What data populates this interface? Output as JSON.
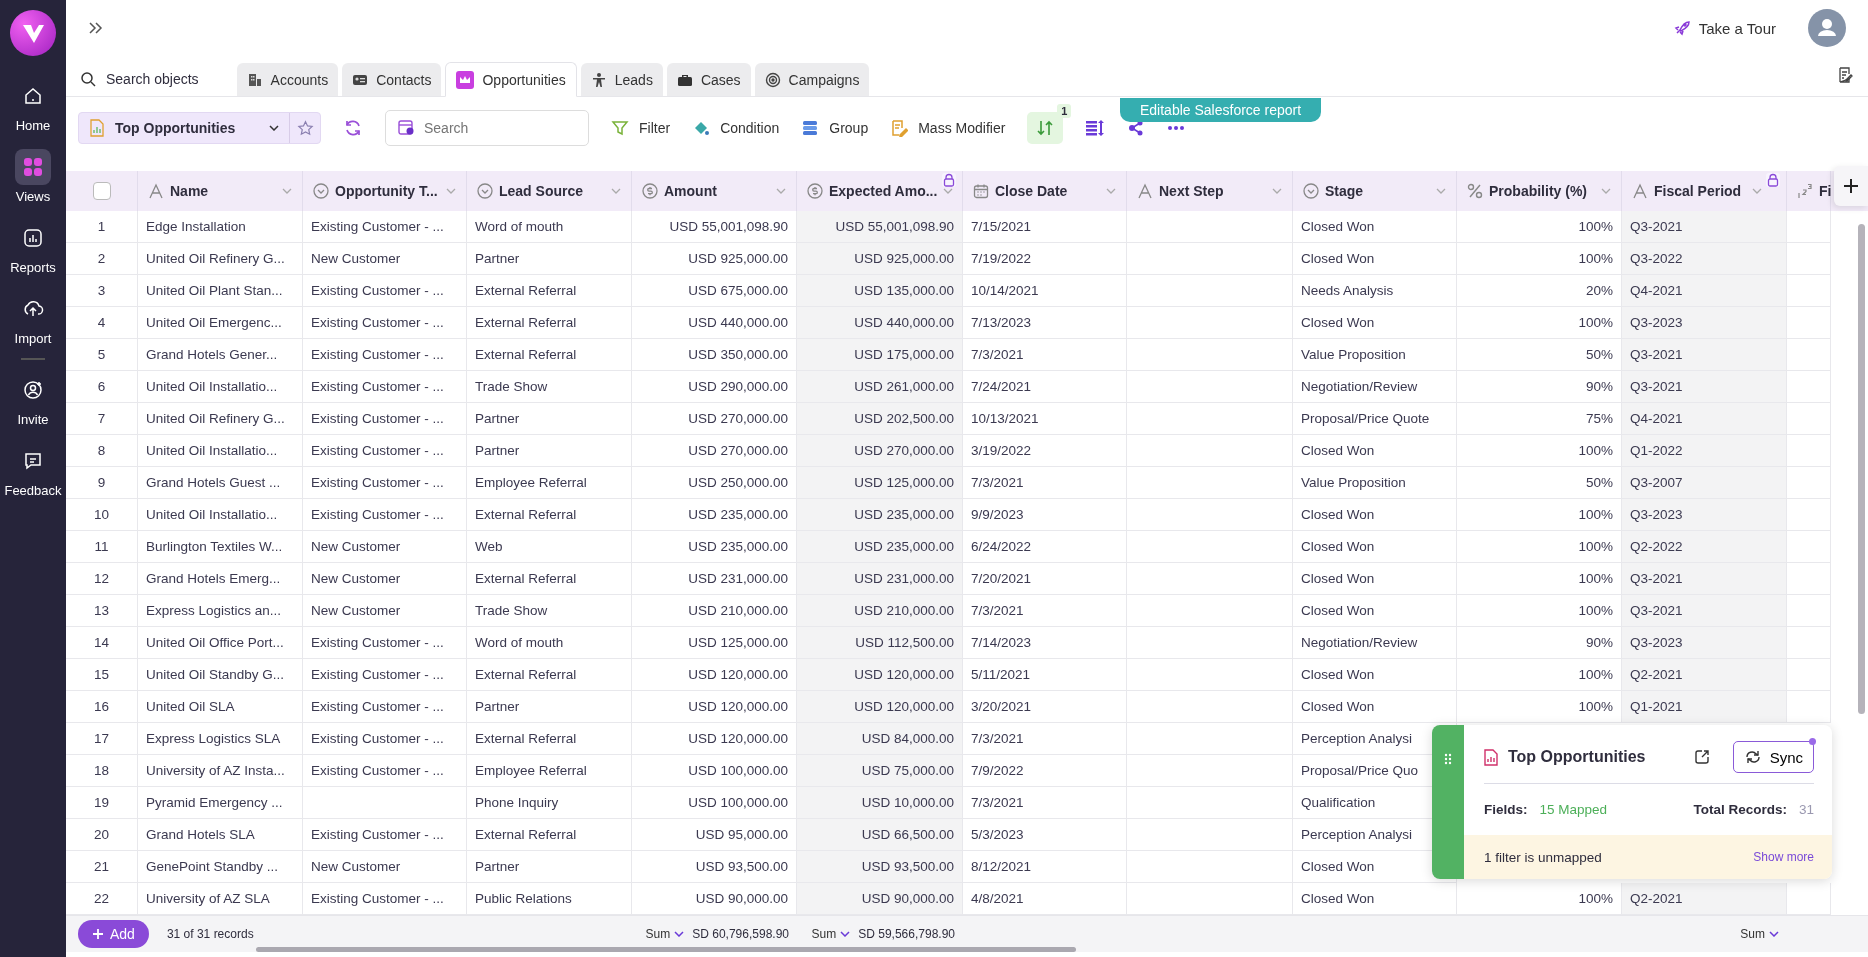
{
  "sidebar": {
    "items": [
      {
        "label": "Home",
        "selected": false
      },
      {
        "label": "Views",
        "selected": true
      },
      {
        "label": "Reports",
        "selected": false
      },
      {
        "label": "Import",
        "selected": false
      },
      {
        "label": "Invite",
        "selected": false
      },
      {
        "label": "Feedback",
        "selected": false
      }
    ]
  },
  "topbar": {
    "tour_label": "Take a Tour"
  },
  "object_tabs": {
    "search_label": "Search objects",
    "tabs": [
      {
        "label": "Accounts",
        "selected": false
      },
      {
        "label": "Contacts",
        "selected": false
      },
      {
        "label": "Opportunities",
        "selected": true
      },
      {
        "label": "Leads",
        "selected": false
      },
      {
        "label": "Cases",
        "selected": false
      },
      {
        "label": "Campaigns",
        "selected": false
      }
    ]
  },
  "toolbar": {
    "view_name": "Top Opportunities",
    "search_placeholder": "Search",
    "actions": [
      {
        "label": "Filter",
        "kind": "filter"
      },
      {
        "label": "Condition",
        "kind": "condition"
      },
      {
        "label": "Group",
        "kind": "group"
      },
      {
        "label": "Mass Modifier",
        "kind": "modifier"
      }
    ],
    "sort": {
      "active": true,
      "badge": "1"
    },
    "banner": "Editable Salesforce report"
  },
  "table": {
    "select_all": {
      "checked": false
    },
    "columns": [
      {
        "label": "Name",
        "kind": "text",
        "locked": false
      },
      {
        "label": "Opportunity T...",
        "kind": "picklist",
        "locked": false
      },
      {
        "label": "Lead Source",
        "kind": "picklist",
        "locked": false
      },
      {
        "label": "Amount",
        "kind": "currency",
        "locked": false,
        "sum": {
          "label": "Sum",
          "value": "SD 60,796,598.90"
        }
      },
      {
        "label": "Expected Amo...",
        "kind": "currency",
        "locked": true,
        "sum": {
          "label": "Sum",
          "value": "SD 59,566,798.90"
        }
      },
      {
        "label": "Close Date",
        "kind": "date",
        "locked": false
      },
      {
        "label": "Next Step",
        "kind": "text",
        "locked": false
      },
      {
        "label": "Stage",
        "kind": "picklist",
        "locked": false
      },
      {
        "label": "Probability (%)",
        "kind": "percent",
        "locked": false
      },
      {
        "label": "Fiscal Period",
        "kind": "text",
        "locked": true,
        "sum": {
          "label": "Sum"
        }
      },
      {
        "label": "Fi",
        "kind": "number",
        "locked": false
      }
    ],
    "rows": [
      {
        "number": "1",
        "cells": [
          "Edge Installation",
          "Existing Customer - ...",
          "Word of mouth",
          "USD 55,001,098.90",
          "USD 55,001,098.90",
          "7/15/2021",
          null,
          "Closed Won",
          "100%",
          "Q3-2021",
          null
        ]
      },
      {
        "number": "2",
        "cells": [
          "United Oil Refinery G...",
          "New Customer",
          "Partner",
          "USD 925,000.00",
          "USD 925,000.00",
          "7/19/2022",
          null,
          "Closed Won",
          "100%",
          "Q3-2022",
          null
        ]
      },
      {
        "number": "3",
        "cells": [
          "United Oil Plant Stan...",
          "Existing Customer - ...",
          "External Referral",
          "USD 675,000.00",
          "USD 135,000.00",
          "10/14/2021",
          null,
          "Needs Analysis",
          "20%",
          "Q4-2021",
          null
        ]
      },
      {
        "number": "4",
        "cells": [
          "United Oil Emergenc...",
          "Existing Customer - ...",
          "External Referral",
          "USD 440,000.00",
          "USD 440,000.00",
          "7/13/2023",
          null,
          "Closed Won",
          "100%",
          "Q3-2023",
          null
        ]
      },
      {
        "number": "5",
        "cells": [
          "Grand Hotels Gener...",
          "Existing Customer - ...",
          "External Referral",
          "USD 350,000.00",
          "USD 175,000.00",
          "7/3/2021",
          null,
          "Value Proposition",
          "50%",
          "Q3-2021",
          null
        ]
      },
      {
        "number": "6",
        "cells": [
          "United Oil Installatio...",
          "Existing Customer - ...",
          "Trade Show",
          "USD 290,000.00",
          "USD 261,000.00",
          "7/24/2021",
          null,
          "Negotiation/Review",
          "90%",
          "Q3-2021",
          null
        ]
      },
      {
        "number": "7",
        "cells": [
          "United Oil Refinery G...",
          "Existing Customer - ...",
          "Partner",
          "USD 270,000.00",
          "USD 202,500.00",
          "10/13/2021",
          null,
          "Proposal/Price Quote",
          "75%",
          "Q4-2021",
          null
        ]
      },
      {
        "number": "8",
        "cells": [
          "United Oil Installatio...",
          "Existing Customer - ...",
          "Partner",
          "USD 270,000.00",
          "USD 270,000.00",
          "3/19/2022",
          null,
          "Closed Won",
          "100%",
          "Q1-2022",
          null
        ]
      },
      {
        "number": "9",
        "cells": [
          "Grand Hotels Guest ...",
          "Existing Customer - ...",
          "Employee Referral",
          "USD 250,000.00",
          "USD 125,000.00",
          "7/3/2021",
          null,
          "Value Proposition",
          "50%",
          "Q3-2007",
          null
        ]
      },
      {
        "number": "10",
        "cells": [
          "United Oil Installatio...",
          "Existing Customer - ...",
          "External Referral",
          "USD 235,000.00",
          "USD 235,000.00",
          "9/9/2023",
          null,
          "Closed Won",
          "100%",
          "Q3-2023",
          null
        ]
      },
      {
        "number": "11",
        "cells": [
          "Burlington Textiles W...",
          "New Customer",
          "Web",
          "USD 235,000.00",
          "USD 235,000.00",
          "6/24/2022",
          null,
          "Closed Won",
          "100%",
          "Q2-2022",
          null
        ]
      },
      {
        "number": "12",
        "cells": [
          "Grand Hotels Emerg...",
          "New Customer",
          "External Referral",
          "USD 231,000.00",
          "USD 231,000.00",
          "7/20/2021",
          null,
          "Closed Won",
          "100%",
          "Q3-2021",
          null
        ]
      },
      {
        "number": "13",
        "cells": [
          "Express Logistics an...",
          "New Customer",
          "Trade Show",
          "USD 210,000.00",
          "USD 210,000.00",
          "7/3/2021",
          null,
          "Closed Won",
          "100%",
          "Q3-2021",
          null
        ]
      },
      {
        "number": "14",
        "cells": [
          "United Oil Office Port...",
          "Existing Customer - ...",
          "Word of mouth",
          "USD 125,000.00",
          "USD 112,500.00",
          "7/14/2023",
          null,
          "Negotiation/Review",
          "90%",
          "Q3-2023",
          null
        ]
      },
      {
        "number": "15",
        "cells": [
          "United Oil Standby G...",
          "Existing Customer - ...",
          "External Referral",
          "USD 120,000.00",
          "USD 120,000.00",
          "5/11/2021",
          null,
          "Closed Won",
          "100%",
          "Q2-2021",
          null
        ]
      },
      {
        "number": "16",
        "cells": [
          "United Oil SLA",
          "Existing Customer - ...",
          "Partner",
          "USD 120,000.00",
          "USD 120,000.00",
          "3/20/2021",
          null,
          "Closed Won",
          "100%",
          "Q1-2021",
          null
        ]
      },
      {
        "number": "17",
        "cells": [
          "Express Logistics SLA",
          "Existing Customer - ...",
          "External Referral",
          "USD 120,000.00",
          "USD 84,000.00",
          "7/3/2021",
          null,
          "Perception Analysi"
        ]
      },
      {
        "number": "18",
        "cells": [
          "University of AZ Insta...",
          "Existing Customer - ...",
          "Employee Referral",
          "USD 100,000.00",
          "USD 75,000.00",
          "7/9/2022",
          null,
          "Proposal/Price Quo"
        ]
      },
      {
        "number": "19",
        "cells": [
          "Pyramid Emergency ...",
          null,
          "Phone Inquiry",
          "USD 100,000.00",
          "USD 10,000.00",
          "7/3/2021",
          null,
          "Qualification"
        ]
      },
      {
        "number": "20",
        "cells": [
          "Grand Hotels SLA",
          "Existing Customer - ...",
          "External Referral",
          "USD 95,000.00",
          "USD 66,500.00",
          "5/3/2023",
          null,
          "Perception Analysi"
        ]
      },
      {
        "number": "21",
        "cells": [
          "GenePoint Standby ...",
          "New Customer",
          "Partner",
          "USD 93,500.00",
          "USD 93,500.00",
          "8/12/2021",
          null,
          "Closed Won"
        ]
      },
      {
        "number": "22",
        "cells": [
          "University of AZ SLA",
          "Existing Customer - ...",
          "Public Relations",
          "USD 90,000.00",
          "USD 90,000.00",
          "4/8/2021",
          null,
          "Closed Won",
          "100%",
          "Q2-2021",
          null
        ]
      }
    ]
  },
  "footer": {
    "add_label": "Add",
    "record_count": "31 of 31 records"
  },
  "sync_panel": {
    "title": "Top Opportunities",
    "sync_label": "Sync",
    "notification": true,
    "fields_label": "Fields:",
    "fields_value": "15 Mapped",
    "total_label": "Total Records:",
    "total_value": "31",
    "warning": "1 filter is unmapped",
    "show_more": "Show more"
  }
}
